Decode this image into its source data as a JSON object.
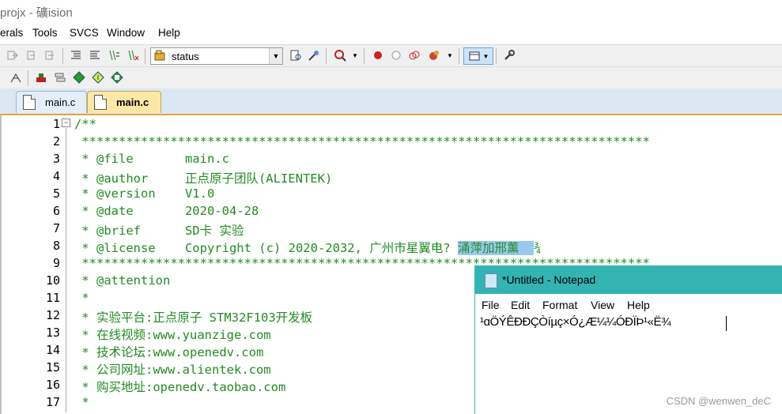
{
  "title": {
    "text": "projx - 礦ision"
  },
  "menu": {
    "items": [
      "erals",
      "Tools",
      "SVCS",
      "Window",
      "Help"
    ]
  },
  "toolbar": {
    "target_combo": "status"
  },
  "tabs": [
    {
      "label": "main.c",
      "active": false
    },
    {
      "label": "main.c",
      "active": true
    }
  ],
  "editor": {
    "line_numbers": [
      "1",
      "2",
      "3",
      "4",
      "5",
      "6",
      "7",
      "8",
      "9",
      "10",
      "11",
      "12",
      "13",
      "14",
      "15",
      "16",
      "17"
    ],
    "lines": [
      "/**",
      " *****************************************************************************",
      " * @file       main.c",
      " * @author     正点原子团队(ALIENTEK)",
      " * @version    V1.0",
      " * @date       2020-04-28",
      " * @brief      SD卡 实验",
      " * @license    Copyright (c) 2020-2032, 广州市星翼电? 涌萍加邢薰  ¾",
      " *****************************************************************************",
      " * @attention",
      " *",
      " * 实验平台:正点原子 STM32F103开发板",
      " * 在线视频:www.yuanzige.com",
      " * 技术论坛:www.openedv.com",
      " * 公司网址:www.alientek.com",
      " * 购买地址:openedv.taobao.com",
      " *"
    ],
    "highlight_text": "涌萍加邢薰  "
  },
  "notepad": {
    "title": "*Untitled - Notepad",
    "menu": [
      "File",
      "Edit",
      "Format",
      "View",
      "Help"
    ],
    "text": "¹ɑÖÝÊÐÐÇÒíµç×Ó¿Æ¼¼ÓÐÏÞ¹«Ë¾"
  },
  "watermark": "CSDN @wenwen_deC"
}
